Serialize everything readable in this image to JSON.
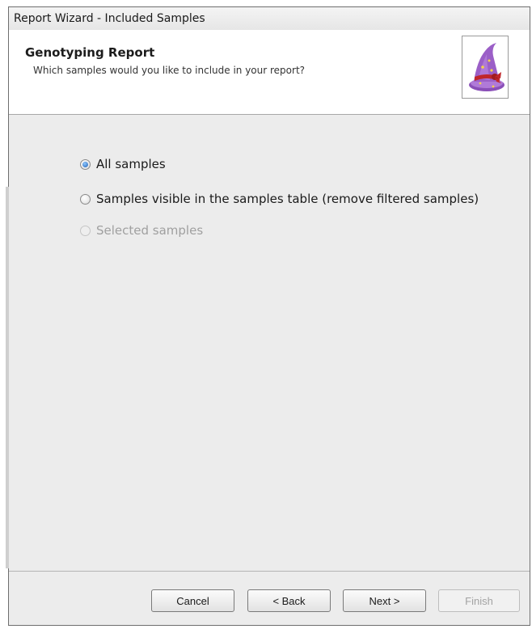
{
  "window": {
    "title": "Report Wizard - Included Samples"
  },
  "header": {
    "title": "Genotyping Report",
    "subtitle": "Which samples would you like to include in your report?",
    "image_icon": "wizard-hat-icon"
  },
  "options": [
    {
      "label": "All samples",
      "checked": true,
      "enabled": true
    },
    {
      "label": "Samples visible in the samples table (remove filtered samples)",
      "checked": false,
      "enabled": true
    },
    {
      "label": "Selected samples",
      "checked": false,
      "enabled": false
    }
  ],
  "footer": {
    "cancel": "Cancel",
    "back": "< Back",
    "next": "Next >",
    "finish": "Finish"
  },
  "colors": {
    "hat": "#9b5fc7",
    "ribbon": "#c0262a",
    "radio_selected": "#1f5fb3"
  }
}
